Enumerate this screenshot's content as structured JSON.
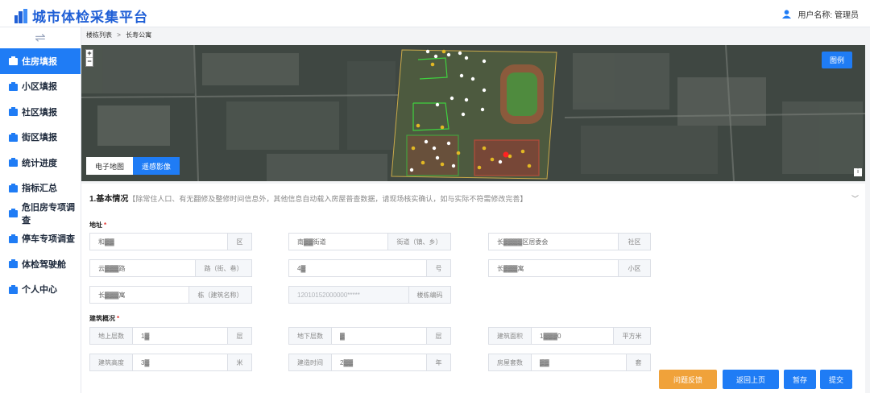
{
  "app": {
    "title": "城市体检采集平台",
    "accent": "#1f7cf5",
    "user_label": "用户名称: 管理员"
  },
  "sidebar": {
    "collapse_icon": "swap-icon",
    "items": [
      {
        "label": "住房填报",
        "icon": "house-icon",
        "active": true
      },
      {
        "label": "小区填报",
        "icon": "building-icon",
        "active": false
      },
      {
        "label": "社区填报",
        "icon": "community-icon",
        "active": false
      },
      {
        "label": "街区填报",
        "icon": "block-icon",
        "active": false
      },
      {
        "label": "统计进度",
        "icon": "hourglass-icon",
        "active": false
      },
      {
        "label": "指标汇总",
        "icon": "chart-icon",
        "active": false
      },
      {
        "label": "危旧房专项调查",
        "icon": "home-alert-icon",
        "active": false
      },
      {
        "label": "停车专项调查",
        "icon": "parking-icon",
        "active": false
      },
      {
        "label": "体检驾驶舱",
        "icon": "monitor-icon",
        "active": false
      },
      {
        "label": "个人中心",
        "icon": "user-icon",
        "active": false
      }
    ]
  },
  "breadcrumb": {
    "root": "楼栋列表",
    "separator": ">",
    "current": "长寿公寓"
  },
  "map": {
    "zoom_in": "+",
    "zoom_out": "−",
    "legend_button": "图例",
    "toggle_electronic": "电子地图",
    "toggle_satellite": "遥感影像",
    "info": "i"
  },
  "form": {
    "section_title": "1.基本情况",
    "section_note": "【除常住人口、有无翻修及整修时间信息外，其他信息自动载入房屋普查数据，请现场核实确认，如与实际不符需修改完善】",
    "address_label": "地址",
    "address_required": "*",
    "district_value": "和▓▓",
    "district_suffix": "区",
    "street_value": "南▓▓街道",
    "street_suffix": "街道（镇、乡）",
    "community_value": "长▓▓▓▓区居委会",
    "community_suffix": "社区",
    "road_value": "云▓▓▓路",
    "road_suffix": "路（街、巷）",
    "number_value": "4▓",
    "number_suffix": "号",
    "estate_value": "长▓▓▓寓",
    "estate_suffix": "小区",
    "building_value": "长▓▓▓寓",
    "building_suffix": "栋（建筑名称）",
    "code_placeholder": "12010152000000*****",
    "code_suffix": "楼栋编码",
    "overview_label": "建筑概况",
    "overview_required": "*",
    "floors_above_prefix": "地上层数",
    "floors_above_value": "1▓",
    "floors_above_suffix": "层",
    "floors_below_prefix": "地下层数",
    "floors_below_value": "▓",
    "floors_below_suffix": "层",
    "area_prefix": "建筑面积",
    "area_value": "1▓▓▓0",
    "area_suffix": "平方米",
    "height_prefix": "建筑高度",
    "height_value": "3▓",
    "height_suffix": "米",
    "year_prefix": "建造时间",
    "year_value": "2▓▓",
    "year_suffix": "年",
    "units_prefix": "房屋套数",
    "units_value": "▓▓",
    "units_suffix": "套"
  },
  "actions": {
    "feedback": "问题反馈",
    "back": "返回上页",
    "save": "暂存",
    "submit": "提交"
  }
}
